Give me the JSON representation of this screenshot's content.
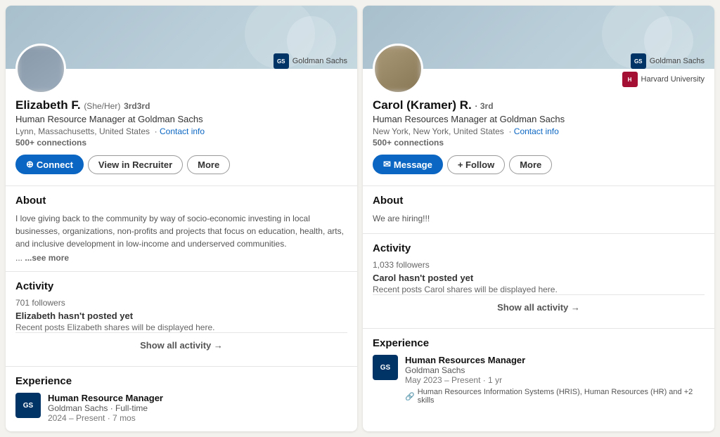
{
  "left": {
    "name": "Elizabeth F.",
    "pronoun": "(She/Her)",
    "degree": "3rd",
    "title": "Human Resource Manager at Goldman Sachs",
    "location": "Lynn, Massachusetts, United States",
    "contact_label": "Contact info",
    "connections": "500+ connections",
    "buttons": {
      "connect": "Connect",
      "view_recruiter": "View in Recruiter",
      "more": "More"
    },
    "companies": [
      {
        "name": "Goldman Sachs",
        "abbr": "GS",
        "color": "#003366"
      }
    ],
    "about": {
      "title": "About",
      "text": "I love giving back to the community by way of socio-economic investing in local businesses, organizations, non-profits and projects that focus on education, health, arts, and inclusive development in low-income and underserved communities.",
      "ellipsis": "...",
      "see_more": "...see more"
    },
    "activity": {
      "title": "Activity",
      "followers": "701 followers",
      "no_post": "Elizabeth hasn't posted yet",
      "sub": "Recent posts Elizabeth shares will be displayed here.",
      "show_all": "Show all activity →"
    },
    "experience": {
      "title": "Experience",
      "role": "Human Resource Manager",
      "company": "Goldman Sachs · Full-time",
      "duration": "2024 – Present · 7 mos",
      "logo_color": "#003366",
      "logo_abbr": "GS"
    }
  },
  "right": {
    "name": "Carol (Kramer) R.",
    "degree": "3rd",
    "title": "Human Resources Manager at Goldman Sachs",
    "location": "New York, New York, United States",
    "contact_label": "Contact info",
    "connections": "500+ connections",
    "buttons": {
      "message": "Message",
      "follow": "+ Follow",
      "more": "More"
    },
    "companies": [
      {
        "name": "Goldman Sachs",
        "abbr": "GS",
        "color": "#003366"
      },
      {
        "name": "Harvard University",
        "abbr": "H",
        "color": "#a41034"
      }
    ],
    "about": {
      "title": "About",
      "text": "We are hiring!!!"
    },
    "activity": {
      "title": "Activity",
      "followers": "1,033 followers",
      "no_post": "Carol hasn't posted yet",
      "sub": "Recent posts Carol shares will be displayed here.",
      "show_all": "Show all activity →"
    },
    "experience": {
      "title": "Experience",
      "role": "Human Resources Manager",
      "company": "Goldman Sachs",
      "duration": "May 2023 – Present · 1 yr",
      "logo_color": "#003366",
      "logo_abbr": "GS",
      "skills": "Human Resources Information Systems (HRIS), Human Resources (HR) and +2 skills"
    }
  }
}
